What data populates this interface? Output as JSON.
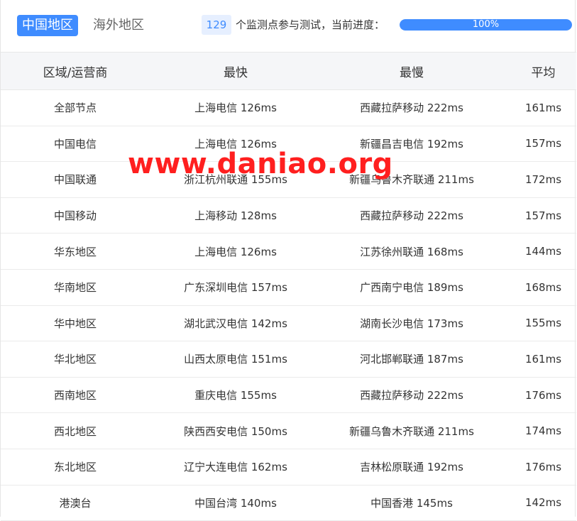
{
  "tabs": {
    "active": "中国地区",
    "inactive": "海外地区"
  },
  "status": {
    "count": "129",
    "text": "个监测点参与测试，当前进度：",
    "progress_label": "100%",
    "progress_fraction": 1.0
  },
  "table": {
    "headers": [
      "区域/运营商",
      "最快",
      "最慢",
      "平均"
    ],
    "rows": [
      [
        "全部节点",
        "上海电信 126ms",
        "西藏拉萨移动 222ms",
        "161ms"
      ],
      [
        "中国电信",
        "上海电信 126ms",
        "新疆昌吉电信 192ms",
        "157ms"
      ],
      [
        "中国联通",
        "浙江杭州联通 155ms",
        "新疆乌鲁木齐联通 211ms",
        "172ms"
      ],
      [
        "中国移动",
        "上海移动 128ms",
        "西藏拉萨移动 222ms",
        "157ms"
      ],
      [
        "华东地区",
        "上海电信 126ms",
        "江苏徐州联通 168ms",
        "144ms"
      ],
      [
        "华南地区",
        "广东深圳电信 157ms",
        "广西南宁电信 189ms",
        "168ms"
      ],
      [
        "华中地区",
        "湖北武汉电信 142ms",
        "湖南长沙电信 173ms",
        "155ms"
      ],
      [
        "华北地区",
        "山西太原电信 151ms",
        "河北邯郸联通 187ms",
        "161ms"
      ],
      [
        "西南地区",
        "重庆电信 155ms",
        "西藏拉萨移动 222ms",
        "176ms"
      ],
      [
        "西北地区",
        "陕西西安电信 150ms",
        "新疆乌鲁木齐联通 211ms",
        "174ms"
      ],
      [
        "东北地区",
        "辽宁大连电信 162ms",
        "吉林松原联通 192ms",
        "176ms"
      ],
      [
        "港澳台",
        "中国台湾 140ms",
        "中国香港 145ms",
        "142ms"
      ]
    ]
  },
  "watermark": "www.daniao.org",
  "colors": {
    "accent": "#3f8cff",
    "watermark": "#ff1f1f"
  }
}
